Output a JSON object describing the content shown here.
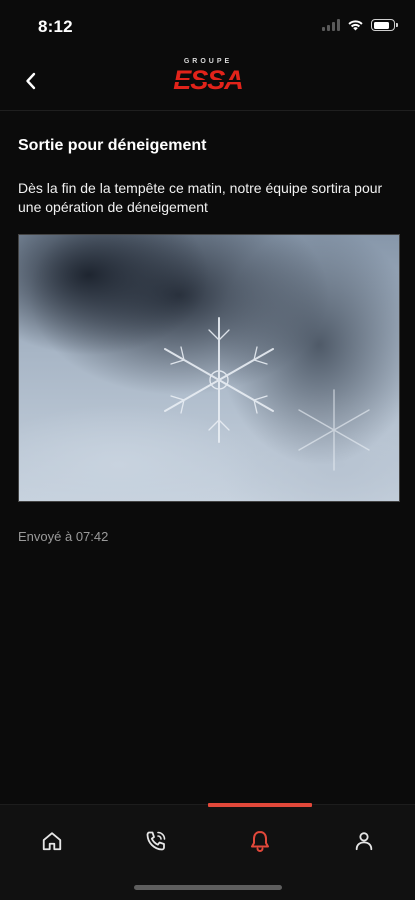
{
  "status_bar": {
    "time": "8:12"
  },
  "header": {
    "logo_top_text": "GROUPE",
    "logo_main_text": "ESSA",
    "brand_color": "#e2231a"
  },
  "notification": {
    "title": "Sortie pour déneigement",
    "body": "Dès la fin de la tempête ce matin, notre équipe sortira pour une opération de déneigement",
    "image_subject": "snowflake photo",
    "sent_time": "Envoyé à 07:42"
  },
  "tabs": [
    {
      "icon": "home-icon",
      "active": false
    },
    {
      "icon": "phone-call-icon",
      "active": false
    },
    {
      "icon": "bell-icon",
      "active": true
    },
    {
      "icon": "user-icon",
      "active": false
    }
  ],
  "colors": {
    "background": "#0b0b0b",
    "accent": "#e2483a",
    "muted_text": "#9a9a9a"
  }
}
